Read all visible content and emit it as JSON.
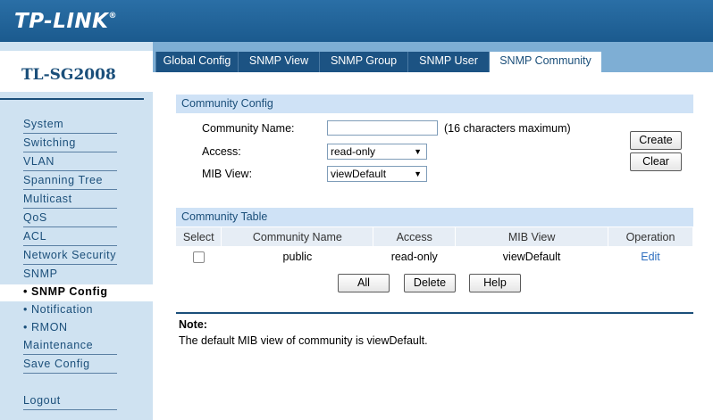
{
  "brand": {
    "logo": "TP-LINK",
    "trademark": "®"
  },
  "model": "TL-SG2008",
  "sidebar": {
    "items": [
      {
        "label": "System"
      },
      {
        "label": "Switching"
      },
      {
        "label": "VLAN"
      },
      {
        "label": "Spanning Tree"
      },
      {
        "label": "Multicast"
      },
      {
        "label": "QoS"
      },
      {
        "label": "ACL"
      },
      {
        "label": "Network Security"
      },
      {
        "label": "SNMP"
      },
      {
        "label": "• SNMP Config",
        "active": true
      },
      {
        "label": "• Notification"
      },
      {
        "label": "• RMON"
      },
      {
        "label": "Maintenance"
      },
      {
        "label": "Save Config"
      },
      {
        "label": "Logout"
      }
    ]
  },
  "tabs": [
    {
      "label": "Global Config"
    },
    {
      "label": "SNMP View"
    },
    {
      "label": "SNMP Group"
    },
    {
      "label": "SNMP User"
    },
    {
      "label": "SNMP Community",
      "active": true
    }
  ],
  "community_config": {
    "title": "Community Config",
    "name_label": "Community Name:",
    "name_value": "",
    "name_hint": "(16 characters maximum)",
    "access_label": "Access:",
    "access_value": "read-only",
    "mib_label": "MIB View:",
    "mib_value": "viewDefault",
    "create_label": "Create",
    "clear_label": "Clear"
  },
  "community_table": {
    "title": "Community Table",
    "columns": [
      "Select",
      "Community Name",
      "Access",
      "MIB View",
      "Operation"
    ],
    "rows": [
      {
        "name": "public",
        "access": "read-only",
        "mib": "viewDefault",
        "operation": "Edit"
      }
    ],
    "all_label": "All",
    "delete_label": "Delete",
    "help_label": "Help"
  },
  "note": {
    "title": "Note:",
    "text": "The default MIB view of community is viewDefault."
  }
}
